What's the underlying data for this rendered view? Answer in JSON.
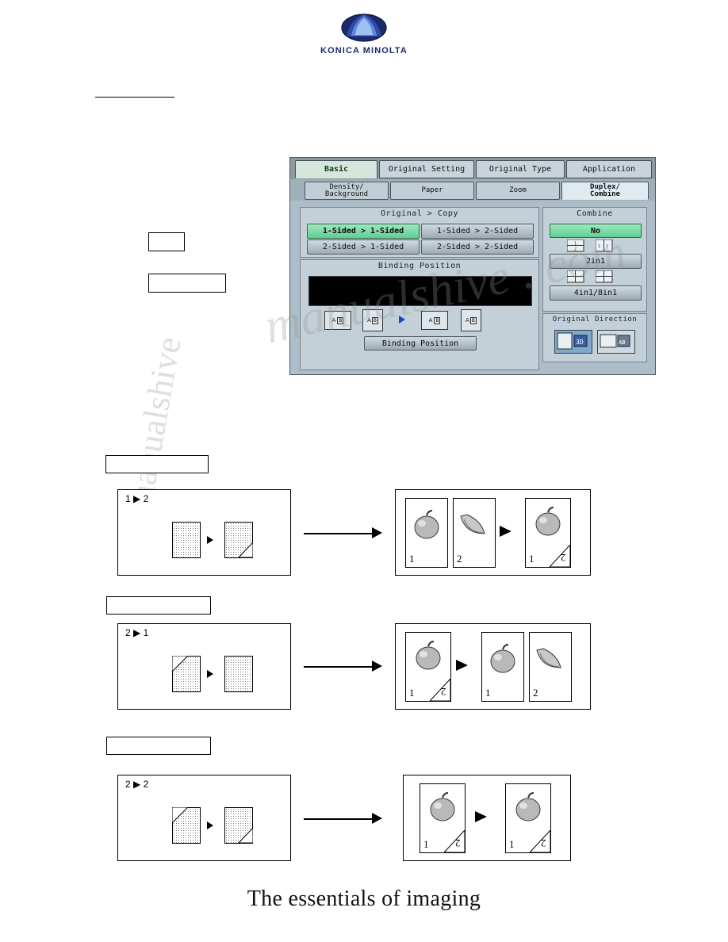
{
  "brand": {
    "name": "KONICA MINOLTA",
    "tagline": "The essentials of imaging"
  },
  "panel": {
    "tabs_row1": [
      {
        "label": "Basic",
        "active": true
      },
      {
        "label": "Original Setting",
        "active": false
      },
      {
        "label": "Original Type",
        "active": false
      },
      {
        "label": "Application",
        "active": false
      }
    ],
    "tabs_row2": [
      {
        "line1": "Density/",
        "line2": "Background",
        "active": false
      },
      {
        "line1": "Paper",
        "line2": "",
        "active": false
      },
      {
        "line1": "Zoom",
        "line2": "",
        "active": false
      },
      {
        "line1": "Duplex/",
        "line2": "Combine",
        "active": true
      }
    ],
    "original_copy": {
      "title": "Original > Copy",
      "buttons": [
        {
          "label": "1-Sided > 1-Sided",
          "selected": true
        },
        {
          "label": "1-Sided > 2-Sided",
          "selected": false
        },
        {
          "label": "2-Sided > 1-Sided",
          "selected": false
        },
        {
          "label": "2-Sided > 2-Sided",
          "selected": false
        }
      ]
    },
    "binding": {
      "title": "Binding Position",
      "button_label": "Binding Position",
      "icons": [
        "A-left-icon",
        "A-top-icon",
        "A-left-icon",
        "A-top-icon"
      ]
    },
    "combine": {
      "title": "Combine",
      "no_label": "No",
      "two_in_one_label": "2in1",
      "four_eight_label": "4in1/8in1"
    },
    "original_direction": {
      "title": "Original Direction",
      "icons": [
        "portrait-direction-icon",
        "landscape-direction-icon"
      ]
    }
  },
  "figures": [
    {
      "header": "1 ▶ 2",
      "left_num": "1",
      "right_num": "2",
      "results": [
        {
          "image": "apple",
          "num": "1",
          "rotated": false,
          "folded": false
        },
        {
          "image": "banana",
          "num": "2",
          "rotated": false,
          "folded": false
        },
        {
          "image": "apple",
          "num": "1",
          "num2": "2",
          "rotated": true,
          "folded": true
        }
      ]
    },
    {
      "header": "2 ▶ 1",
      "left_num": "2",
      "right_num": "1",
      "results": [
        {
          "image": "apple",
          "num": "1",
          "num2": "2",
          "rotated": true,
          "folded": true
        },
        {
          "image": "apple",
          "num": "1",
          "rotated": false,
          "folded": false
        },
        {
          "image": "banana",
          "num": "2",
          "rotated": false,
          "folded": false
        }
      ]
    },
    {
      "header": "2 ▶ 2",
      "left_num": "2",
      "right_num": "2",
      "results": [
        {
          "image": "apple",
          "num": "1",
          "num2": "2",
          "rotated": true,
          "folded": true
        },
        {
          "image": "apple",
          "num": "1",
          "num2": "2",
          "rotated": true,
          "folded": true
        }
      ]
    }
  ],
  "watermark": {
    "line1": "manualshive . com",
    "line2": "manualshive"
  }
}
